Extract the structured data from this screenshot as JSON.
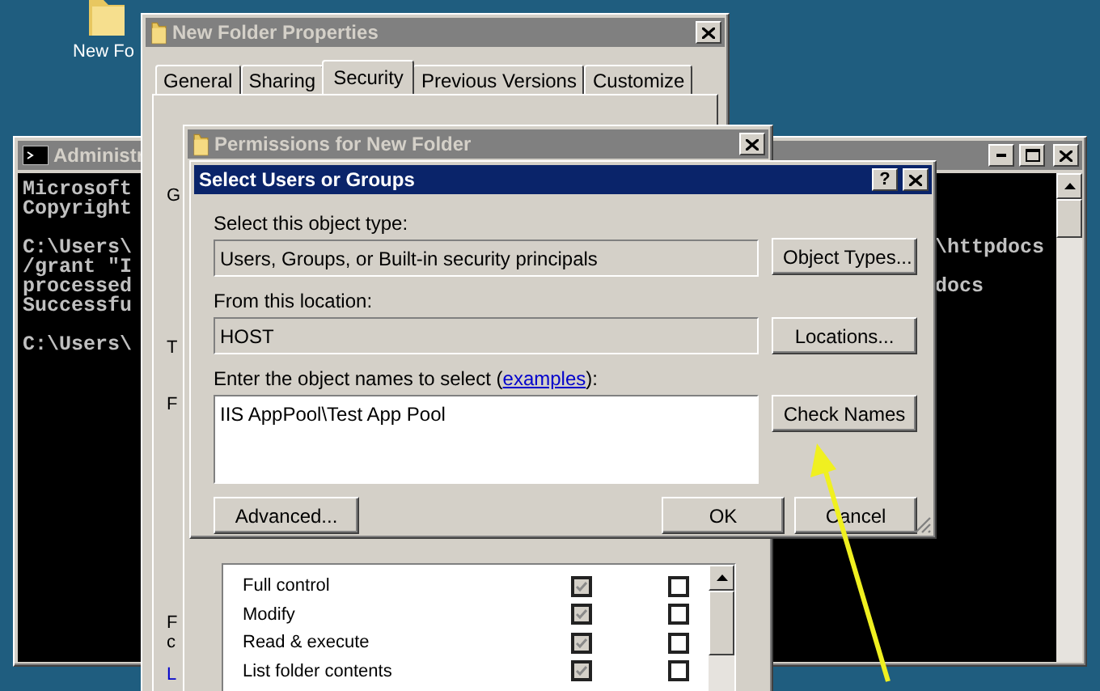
{
  "desktop": {
    "icon_label": "New Fo"
  },
  "console": {
    "title": "Administr",
    "blocks": [
      {
        "lines": [
          {
            "text": "Microsoft"
          },
          {
            "text": "Copyright"
          }
        ]
      },
      {
        "lines": [
          {
            "text": "C:\\Users\\",
            "tail": "\\httpdocs"
          },
          {
            "text": "/grant \"I"
          },
          {
            "text": "processed",
            "tail": "docs"
          },
          {
            "text": "Successfu"
          }
        ]
      },
      {
        "lines": [
          {
            "text": "C:\\Users\\"
          }
        ]
      }
    ]
  },
  "properties": {
    "title": "New Folder Properties",
    "tabs": [
      {
        "label": "General",
        "selected": false
      },
      {
        "label": "Sharing",
        "selected": false
      },
      {
        "label": "Security",
        "selected": true
      },
      {
        "label": "Previous Versions",
        "selected": false
      },
      {
        "label": "Customize",
        "selected": false
      }
    ],
    "clipped_labels": [
      {
        "text": "G",
        "kind": "label"
      },
      {
        "text": "T",
        "kind": "label"
      },
      {
        "text": "F",
        "kind": "label"
      },
      {
        "text": "F",
        "kind": "label"
      },
      {
        "text": "c",
        "kind": "label"
      },
      {
        "text": "L",
        "kind": "link"
      }
    ]
  },
  "permissions": {
    "title": "Permissions for New Folder",
    "rows": [
      {
        "name": "Full control",
        "allow": true,
        "allow_disabled": true,
        "deny": false
      },
      {
        "name": "Modify",
        "allow": true,
        "allow_disabled": true,
        "deny": false
      },
      {
        "name": "Read & execute",
        "allow": true,
        "allow_disabled": true,
        "deny": false
      },
      {
        "name": "List folder contents",
        "allow": true,
        "allow_disabled": true,
        "deny": false
      }
    ]
  },
  "dialog": {
    "title": "Select Users or Groups",
    "help": "?",
    "object_type_label": "Select this object type:",
    "object_type": "Users, Groups, or Built-in security principals",
    "object_type_button": "Object Types...",
    "location_label": "From this location:",
    "location": "HOST",
    "location_button": "Locations...",
    "names_label": {
      "before": "Enter the object names to select (",
      "link": "examples",
      "after": "):"
    },
    "names_value": "IIS AppPool\\Test App Pool",
    "check_button": "Check Names",
    "advanced_button": "Advanced...",
    "ok_button": "OK",
    "cancel_button": "Cancel"
  }
}
